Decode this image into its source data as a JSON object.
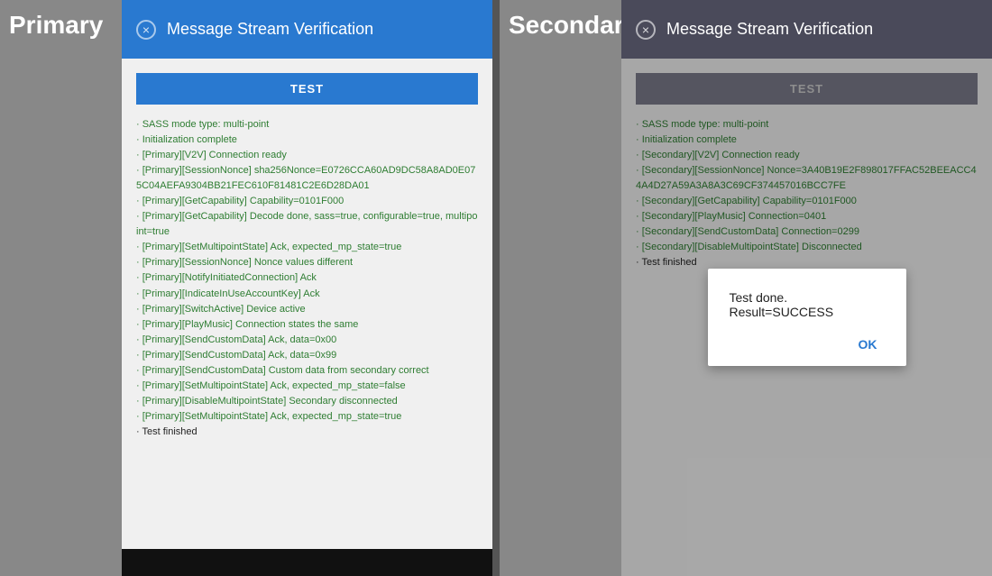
{
  "primary": {
    "label": "Primary",
    "header": {
      "title": "Message Stream Verification",
      "close_icon": "×"
    },
    "test_button": "TEST",
    "log_lines": [
      "· SASS mode type: multi-point",
      "· Initialization complete",
      "· [Primary][V2V] Connection ready",
      "· [Primary][SessionNonce] sha256Nonce=E0726CCA60AD9DC58A8AD0E075C04AEFA9304BB21FEC610F81481C2E6D28DA01",
      "· [Primary][GetCapability] Capability=0101F000",
      "· [Primary][GetCapability] Decode done, sass=true, configurable=true, multipoint=true",
      "· [Primary][SetMultipointState] Ack, expected_mp_state=true",
      "· [Primary][SessionNonce] Nonce values different",
      "· [Primary][NotifyInitiatedConnection] Ack",
      "· [Primary][IndicateInUseAccountKey] Ack",
      "· [Primary][SwitchActive] Device active",
      "· [Primary][PlayMusic] Connection states the same",
      "· [Primary][SendCustomData] Ack, data=0x00",
      "· [Primary][SendCustomData] Ack, data=0x99",
      "· [Primary][SendCustomData] Custom data from secondary correct",
      "· [Primary][SetMultipointState] Ack, expected_mp_state=false",
      "· [Primary][DisableMultipointState] Secondary disconnected",
      "· [Primary][SetMultipointState] Ack, expected_mp_state=true",
      "· Test finished"
    ]
  },
  "secondary": {
    "label": "Secondary",
    "header": {
      "title": "Message Stream Verification",
      "close_icon": "×"
    },
    "test_button": "TEST",
    "log_lines": [
      "· SASS mode type: multi-point",
      "· Initialization complete",
      "· [Secondary][V2V] Connection ready",
      "· [Secondary][SessionNonce] Nonce=3A40B19E2F898017FFAC52BEEACC44A4D27A59A3A8A3C69CF374457016BCC7FE",
      "· [Secondary][GetCapability] Capability=0101F000",
      "· [Secondary][PlayMusic] Connection=0401",
      "· [Secondary][SendCustomData] Connection=0299",
      "· [Secondary][DisableMultipointState] Disconnected",
      "· Test finished"
    ],
    "dialog": {
      "text": "Test done. Result=SUCCESS",
      "ok_label": "OK"
    }
  }
}
